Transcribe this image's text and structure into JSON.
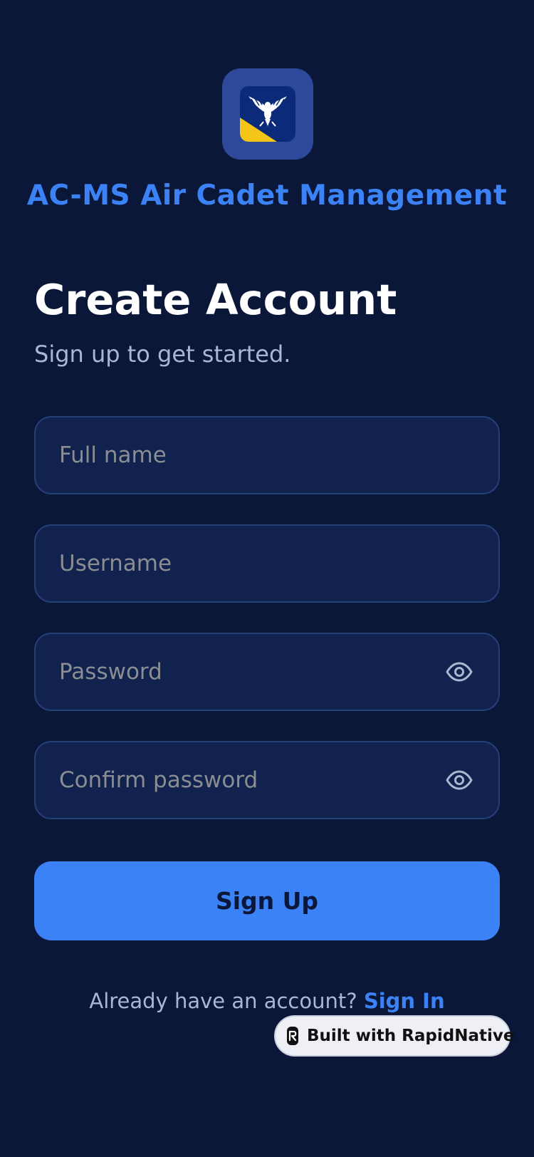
{
  "app": {
    "name": "AC-MS Air Cadet Management",
    "logo_icon": "eagle-emblem-icon"
  },
  "header": {
    "title": "Create Account",
    "subtitle": "Sign up to get started."
  },
  "form": {
    "full_name": {
      "placeholder": "Full name",
      "value": ""
    },
    "username": {
      "placeholder": "Username",
      "value": ""
    },
    "password": {
      "placeholder": "Password",
      "value": "",
      "toggle_icon": "eye-icon"
    },
    "confirm_password": {
      "placeholder": "Confirm password",
      "value": "",
      "toggle_icon": "eye-icon"
    },
    "submit_label": "Sign Up"
  },
  "footer": {
    "prompt": "Already have an account?",
    "link_label": "Sign In"
  },
  "badge": {
    "label": "Built with RapidNative",
    "icon": "rapidnative-logo-icon"
  },
  "colors": {
    "background": "#0b1739",
    "accent": "#3b82f6",
    "field_background": "#10224d",
    "field_border": "#253f75",
    "muted_text": "#a9b7d0",
    "placeholder_text": "#8a8d92",
    "logo_tile": "#2d4a9a",
    "emblem_gold": "#f5c518"
  }
}
